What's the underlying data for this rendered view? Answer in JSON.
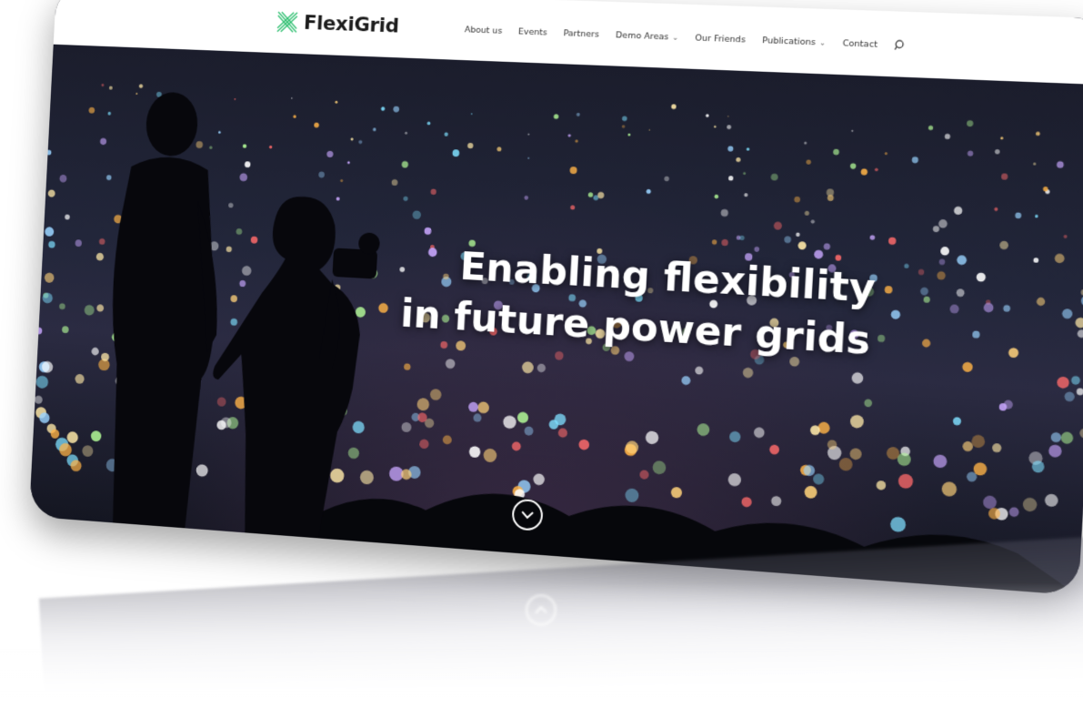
{
  "brand": {
    "name": "FlexiGrid",
    "logo_icon": "x-grid-logo-icon",
    "accent_color": "#2fbf71"
  },
  "nav": {
    "items": [
      {
        "label": "About us",
        "has_dropdown": false
      },
      {
        "label": "Events",
        "has_dropdown": false
      },
      {
        "label": "Partners",
        "has_dropdown": false
      },
      {
        "label": "Demo Areas",
        "has_dropdown": true
      },
      {
        "label": "Our Friends",
        "has_dropdown": false
      },
      {
        "label": "Publications",
        "has_dropdown": true
      },
      {
        "label": "Contact",
        "has_dropdown": false
      }
    ],
    "search_icon": "search-icon",
    "dropdown_icon": "chevron-down-icon"
  },
  "hero": {
    "headline_line1": "Enabling flexibility",
    "headline_line2": "in future power grids",
    "scroll_icon": "chevron-down-circle-icon",
    "background": "night-city-bokeh-photo"
  }
}
